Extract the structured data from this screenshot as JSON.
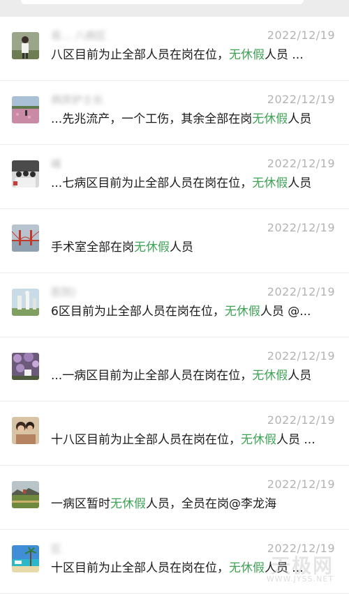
{
  "chats": [
    {
      "name": "易... 八病区",
      "date": "2022/12/19",
      "msg_pre": "八区目前为止全部人员在岗在位，",
      "msg_hl": "无休假",
      "msg_post": "人员 ...",
      "avatar": "person-outdoor-avatar"
    },
    {
      "name": "病房护士长",
      "date": "2022/12/19",
      "msg_pre": "...先兆流产，一个工伤，其余全部在岗",
      "msg_hl": "无休假",
      "msg_post": "人员",
      "avatar": "flower-field-avatar"
    },
    {
      "name": "峰",
      "date": "2022/12/19",
      "msg_pre": "...七病区目前为止全部人员在岗在位，",
      "msg_hl": "无休假",
      "msg_post": "人员",
      "avatar": "group-photo-avatar"
    },
    {
      "name": "",
      "date": "2022/12/19",
      "msg_pre": "手术室全部在岗",
      "msg_hl": "无休假",
      "msg_post": "人员",
      "avatar": "bridge-avatar"
    },
    {
      "name": "医院)",
      "date": "2022/12/19",
      "msg_pre": "6区目前为止全部人员在岗在位，",
      "msg_hl": "无休假",
      "msg_post": "人员 @...",
      "avatar": "statue-avatar"
    },
    {
      "name": "",
      "date": "2022/12/19",
      "msg_pre": "...一病区目前为止全部人员在岗在位，",
      "msg_hl": "无休假",
      "msg_post": "人员",
      "avatar": "purple-flowers-avatar"
    },
    {
      "name": "",
      "date": "2022/12/19",
      "msg_pre": "十八区目前为止全部人员在岗在位，",
      "msg_hl": "无休假",
      "msg_post": "人员 ...",
      "avatar": "couple-avatar"
    },
    {
      "name": "",
      "date": "2022/12/19",
      "msg_pre": "一病区暂时",
      "msg_hl": "无休假",
      "msg_post": "人员，全员在岗@李龙海",
      "avatar": "landscape-avatar"
    },
    {
      "name": "区",
      "date": "2022/12/19",
      "msg_pre": "十区目前为止全部人员在岗在位，",
      "msg_hl": "无休假",
      "msg_post": "人员 ...",
      "avatar": "beach-avatar"
    }
  ],
  "watermark": {
    "main": "天极网",
    "sub": "WWW.JYSS.NET"
  },
  "colors": {
    "highlight": "#3fa356",
    "date": "#b3b3b3",
    "divider": "#ececec"
  }
}
